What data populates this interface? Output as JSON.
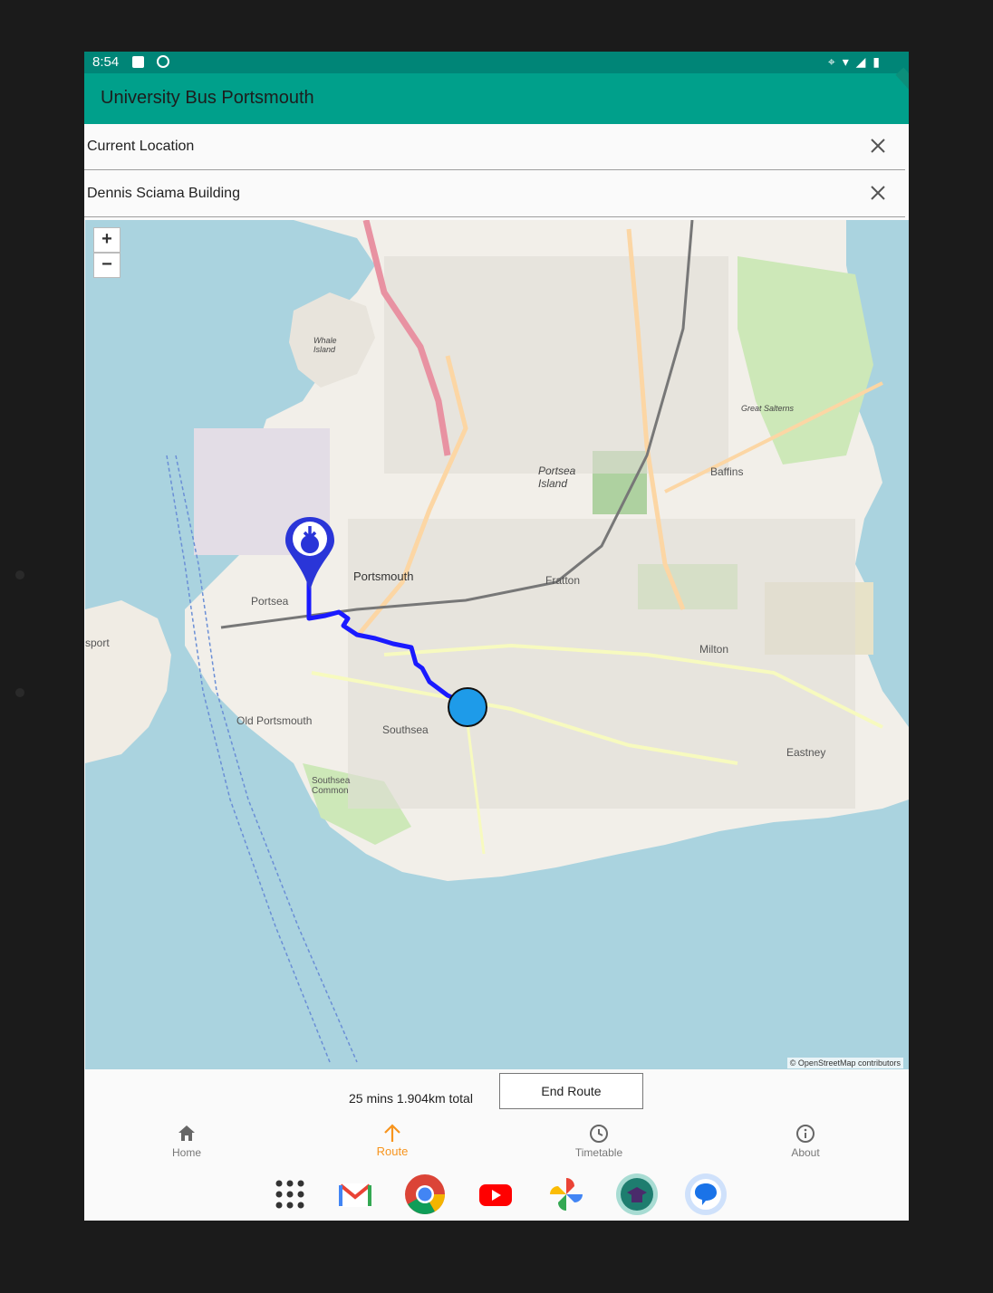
{
  "status_bar": {
    "time": "8:54"
  },
  "app_bar": {
    "title": "University Bus Portsmouth"
  },
  "origin_field": {
    "value": "Current Location"
  },
  "destination_field": {
    "value": "Dennis Sciama Building"
  },
  "map": {
    "zoom_in_label": "+",
    "zoom_out_label": "−",
    "attribution": "© OpenStreetMap contributors",
    "labels": {
      "portsmouth": "Portsmouth",
      "portsea_island": "Portsea Island",
      "fratton": "Fratton",
      "southsea": "Southsea",
      "old_portsmouth": "Old Portsmouth",
      "portsea": "Portsea",
      "milton": "Milton",
      "eastney": "Eastney",
      "baffins": "Baffins",
      "whale_island": "Whale Island",
      "great_salterns": "Great Salterns",
      "southsea_common": "Southsea Common",
      "gosport": "sport"
    },
    "colors": {
      "water": "#aad3df",
      "land": "#f2efe9",
      "route": "#1a1aff",
      "origin_marker": "#1e9be9",
      "destination_pin": "#2a35d8"
    }
  },
  "route": {
    "summary": "25 mins 1.904km total",
    "end_button": "End Route"
  },
  "bottom_nav": {
    "items": [
      {
        "label": "Home",
        "icon": "home-icon"
      },
      {
        "label": "Route",
        "icon": "arrow-up-icon",
        "active": true
      },
      {
        "label": "Timetable",
        "icon": "clock-icon"
      },
      {
        "label": "About",
        "icon": "info-icon"
      }
    ]
  },
  "dock": {
    "apps": [
      "app-drawer-icon",
      "gmail-icon",
      "chrome-icon",
      "youtube-icon",
      "photos-icon",
      "classroom-icon",
      "messages-icon"
    ]
  }
}
